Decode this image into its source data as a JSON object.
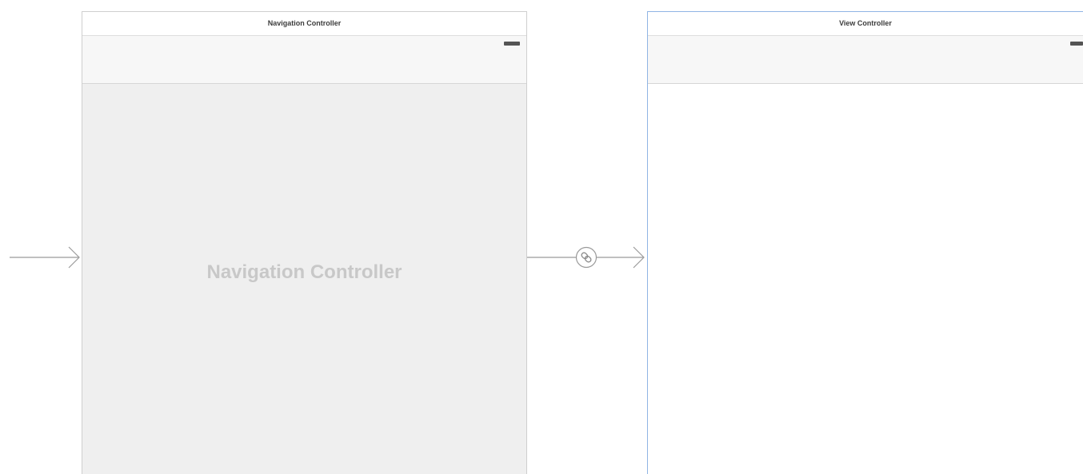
{
  "storyboard": {
    "navigation_controller": {
      "title": "Navigation Controller",
      "placeholder": "Navigation Controller"
    },
    "view_controller": {
      "title": "View Controller"
    },
    "segue": {
      "icon": "link-icon"
    }
  },
  "colors": {
    "scene_border": "#cfcfcf",
    "selected_border": "#8fb4e4",
    "nav_content_bg": "#efefef",
    "placeholder_text": "#c8c8c8",
    "arrow": "#9a9a9a"
  }
}
